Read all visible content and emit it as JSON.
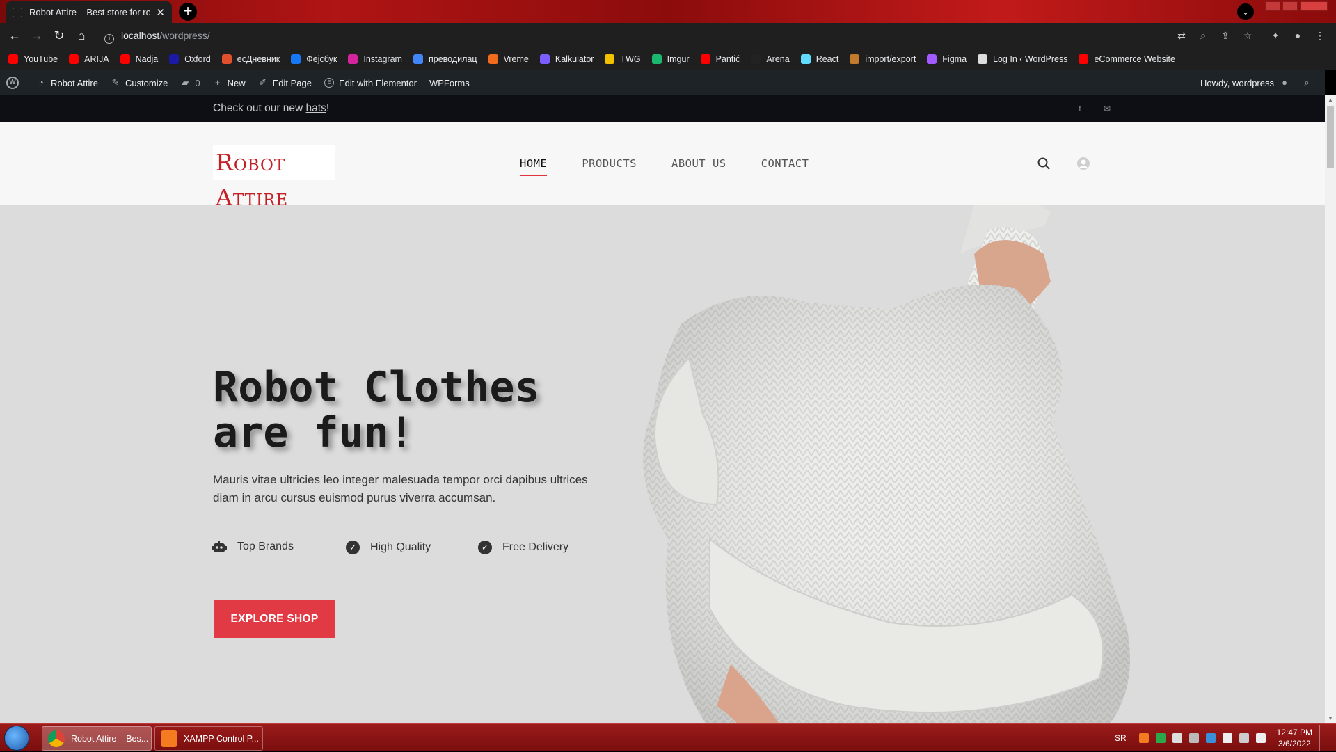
{
  "browser": {
    "tab_title": "Robot Attire – Best store for robo",
    "url_host": "localhost",
    "url_path": "/wordpress/",
    "bookmarks": [
      {
        "label": "YouTube",
        "color": "#ff0000"
      },
      {
        "label": "ARIJA",
        "color": "#ff0000"
      },
      {
        "label": "Nadja",
        "color": "#ff0000"
      },
      {
        "label": "Oxford",
        "color": "#1a1aa6"
      },
      {
        "label": "есДневник",
        "color": "#e0502c"
      },
      {
        "label": "Фејсбук",
        "color": "#1877f2"
      },
      {
        "label": "Instagram",
        "color": "#d6249f"
      },
      {
        "label": "преводилац",
        "color": "#4285f4"
      },
      {
        "label": "Vreme",
        "color": "#f26b1d"
      },
      {
        "label": "Kalkulator",
        "color": "#7b5cff"
      },
      {
        "label": "TWG",
        "color": "#f2c200"
      },
      {
        "label": "Imgur",
        "color": "#1bb76e"
      },
      {
        "label": "Pantić",
        "color": "#ff0000"
      },
      {
        "label": "Arena",
        "color": "#222222"
      },
      {
        "label": "React",
        "color": "#61dafb"
      },
      {
        "label": "import/export",
        "color": "#c47a2c"
      },
      {
        "label": "Figma",
        "color": "#a259ff"
      },
      {
        "label": "Log In ‹ WordPress",
        "color": "#dddddd"
      },
      {
        "label": "eCommerce Website",
        "color": "#ff0000"
      }
    ]
  },
  "admin_bar": {
    "site_name": "Robot Attire",
    "customize": "Customize",
    "comments_count": "0",
    "new": "New",
    "edit_page": "Edit Page",
    "elementor": "Edit with Elementor",
    "wpforms": "WPForms",
    "howdy": "Howdy, wordpress"
  },
  "site": {
    "topbar_text": "Check out our new ",
    "topbar_link": "hats",
    "topbar_suffix": "!",
    "logo": "Robot Attire",
    "menu": [
      "HOME",
      "PRODUCTS",
      "ABOUT US",
      "CONTACT"
    ],
    "hero_title_line1": "Robot Clothes",
    "hero_title_line2": "are fun!",
    "hero_text": "Mauris vitae ultricies leo integer malesuada tempor orci dapibus ultrices diam in arcu cursus euismod purus viverra accumsan.",
    "features": [
      "Top Brands",
      "High Quality",
      "Free Delivery"
    ],
    "cta": "EXPLORE SHOP"
  },
  "taskbar": {
    "items": [
      "Robot Attire – Bes...",
      "XAMPP Control P..."
    ],
    "lang": "SR",
    "time": "12:47 PM",
    "date": "3/6/2022"
  },
  "colors": {
    "accent": "#e23a44",
    "admin_bar": "#1d2327",
    "topbar": "#0e0f14",
    "hero_bg": "#dcdcdd"
  }
}
